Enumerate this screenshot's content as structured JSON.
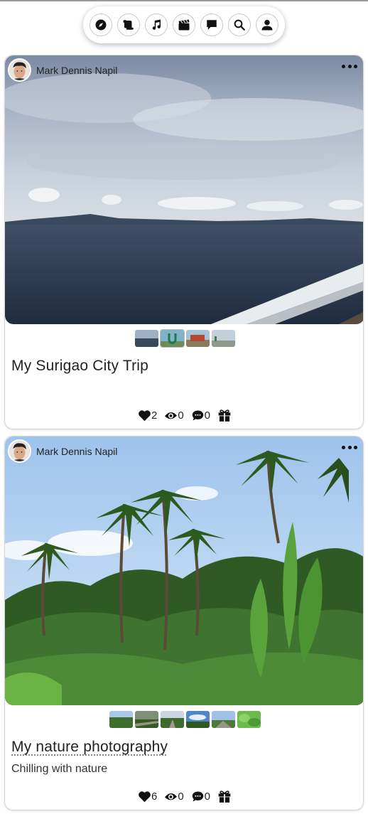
{
  "nav": {
    "items": [
      {
        "name": "explore",
        "icon": "compass-icon"
      },
      {
        "name": "stories",
        "icon": "scroll-icon"
      },
      {
        "name": "music",
        "icon": "music-note-icon"
      },
      {
        "name": "videos",
        "icon": "clapperboard-icon"
      },
      {
        "name": "messages",
        "icon": "chat-bubble-icon"
      },
      {
        "name": "search",
        "icon": "search-icon"
      },
      {
        "name": "profile",
        "icon": "user-icon"
      }
    ]
  },
  "posts": [
    {
      "author": "Mark Dennis Napil",
      "title": "My Surigao City Trip",
      "subtitle": "",
      "thumbnail_count": 4,
      "stats": {
        "likes": "2",
        "views": "0",
        "comments": "0"
      }
    },
    {
      "author": "Mark Dennis Napil",
      "title": "My nature photography",
      "subtitle": "Chilling with nature",
      "thumbnail_count": 6,
      "stats": {
        "likes": "6",
        "views": "0",
        "comments": "0"
      }
    }
  ]
}
